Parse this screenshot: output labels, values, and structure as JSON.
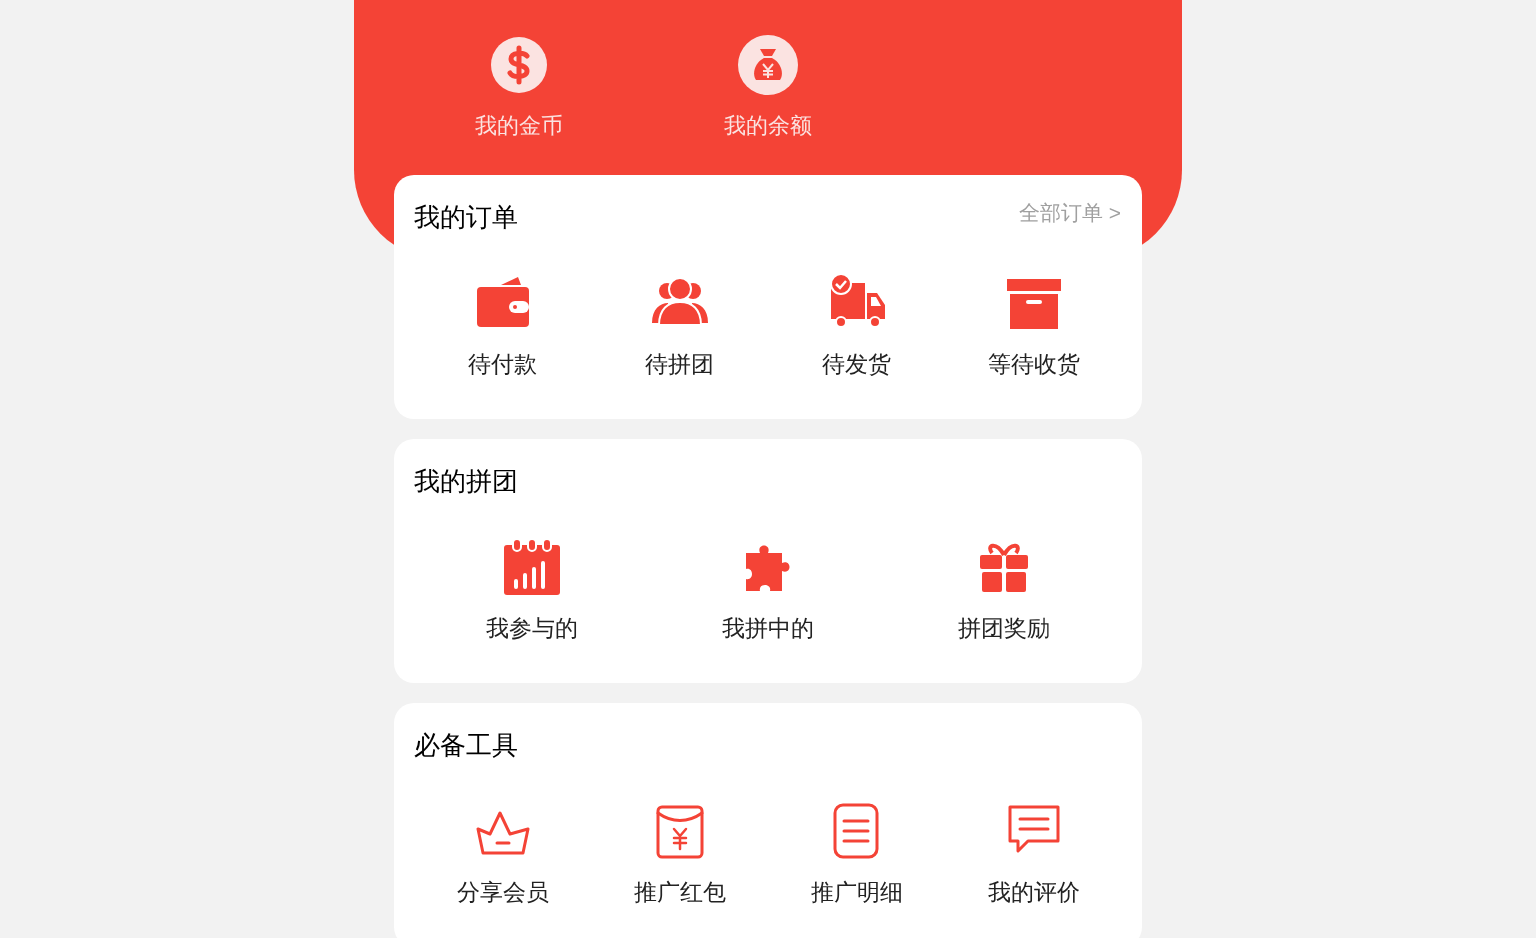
{
  "header": {
    "items": [
      {
        "label": "我的金币"
      },
      {
        "label": "我的余额"
      }
    ]
  },
  "sections": [
    {
      "title": "我的订单",
      "link": "全部订单 >",
      "items": [
        {
          "label": "待付款"
        },
        {
          "label": "待拼团"
        },
        {
          "label": "待发货"
        },
        {
          "label": "等待收货"
        }
      ]
    },
    {
      "title": "我的拼团",
      "items": [
        {
          "label": "我参与的"
        },
        {
          "label": "我拼中的"
        },
        {
          "label": "拼团奖励"
        }
      ]
    },
    {
      "title": "必备工具",
      "items": [
        {
          "label": "分享会员"
        },
        {
          "label": "推广红包"
        },
        {
          "label": "推广明细"
        },
        {
          "label": "我的评价"
        }
      ]
    }
  ]
}
